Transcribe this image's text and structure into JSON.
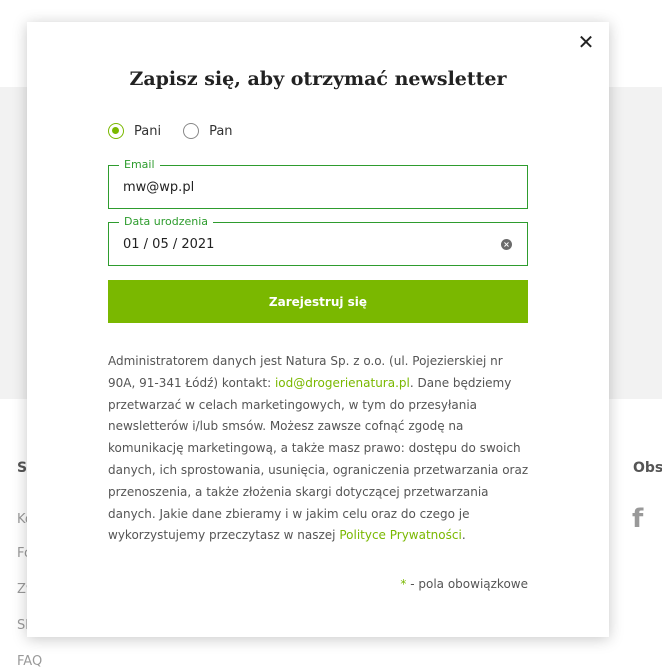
{
  "background": {
    "footer_left_items": [
      "Sk",
      "Ko",
      "Fo",
      "Zw",
      "Sk",
      "FAQ"
    ],
    "footer_right_heading": "Obse",
    "social_icon": "facebook-icon"
  },
  "modal": {
    "close_icon": "close-icon",
    "title": "Zapisz się, aby otrzymać newsletter",
    "gender": {
      "options": [
        {
          "label": "Pani",
          "selected": true
        },
        {
          "label": "Pan",
          "selected": false
        }
      ]
    },
    "email": {
      "label": "Email",
      "value": "mw@wp.pl"
    },
    "birthdate": {
      "label": "Data urodzenia",
      "value": "01 / 05 / 2021"
    },
    "submit_label": "Zarejestruj się",
    "legal": {
      "text_before_email": "Administratorem danych jest Natura Sp. z o.o. (ul. Pojezierskiej nr 90A, 91-341 Łódź) kontakt: ",
      "email_link": "iod@drogerienatura.pl",
      "text_after_email": ". Dane będziemy przetwarzać w celach marketingowych, w tym do przesyłania newsletterów i/lub smsów. Możesz zawsze cofnąć zgodę na komunikację marketingową, a także masz prawo: dostępu do swoich danych, ich sprostowania, usunięcia, ograniczenia przetwarzania oraz przenoszenia, a także złożenia skargi dotyczącej przetwarzania danych. Jakie dane zbieramy i w jakim celu oraz do czego je wykorzystujemy przeczytasz w naszej ",
      "policy_link": "Polityce Prywatności",
      "text_end": "."
    },
    "required_star": "*",
    "required_note": " - pola obowiązkowe"
  },
  "colors": {
    "accent": "#7ab800",
    "field_border": "#2e9c2e"
  }
}
